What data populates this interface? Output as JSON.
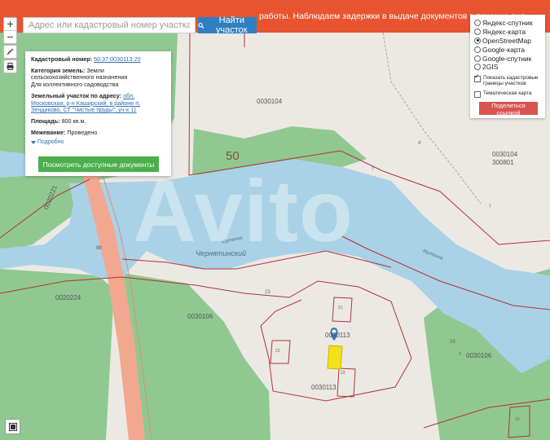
{
  "banner": {
    "text": "работы. Наблюдаем задержки в выдаче документов в течение дня."
  },
  "search": {
    "placeholder": "Адрес или кадастровый номер участка",
    "button_label": "Найти участок"
  },
  "zoom": {
    "plus": "+",
    "minus": "−"
  },
  "info": {
    "cad_label": "Кадастровый номер:",
    "cad_value": "50:37:0030113:20",
    "cat_label": "Категория земель:",
    "cat_value": "Земли сельскохозяйственного назначения",
    "use_value": "Для коллективного садоводства",
    "addr_label": "Земельный участок по адресу:",
    "addr_value": "обл. Московская, р-н Каширский, в районе п. Зендиково, СТ \"Чистые пруды\", уч-к 11",
    "area_label": "Площадь:",
    "area_value": "800 кв.м.",
    "survey_label": "Межевание:",
    "survey_value": "Проведено",
    "more_label": "Подробно",
    "docs_button": "Посмотреть доступные документы"
  },
  "layers": {
    "options": [
      {
        "label": "Яндекс-спутник",
        "selected": false
      },
      {
        "label": "Яндекс-карта",
        "selected": false
      },
      {
        "label": "OpenStreetMap",
        "selected": true
      },
      {
        "label": "Google-карта",
        "selected": false
      },
      {
        "label": "Google-спутник",
        "selected": false
      },
      {
        "label": "2GIS",
        "selected": false
      }
    ],
    "show_boundaries": "Показать кадастровые границы участков",
    "thematic": "Тематическая карта",
    "share_button": "Поделиться ссылкой"
  },
  "map_labels": {
    "quarter_50": "50",
    "q_0030104": "0030104",
    "q_0030104_b": "0030104",
    "q_300801": "300801",
    "q_0020221": "0020221",
    "q_0020224": "0020224",
    "q_0030106": "0030106",
    "q_0030106_b": "0030106",
    "q_0030113_a": "0030113",
    "q_0030113_b": "0030113",
    "river": "Чернятинский",
    "stream_a": "Мутенка",
    "stream_b": "Мутенка",
    "n14": "14",
    "n4": "4",
    "n23": "23",
    "n26": "26",
    "n21": "21",
    "n22": "22",
    "n23b": "23",
    "n20": "20",
    "n98": "98",
    "n6": "6",
    "n7": "7",
    "n1": "1"
  },
  "watermark": "Avito",
  "colors": {
    "forest": "#8fc991",
    "water": "#a9d2e6",
    "land": "#ece9e4",
    "road": "#f2a88e",
    "boundary": "#b3313a",
    "banner": "#e8542f",
    "parcel": "#f3e21a"
  }
}
